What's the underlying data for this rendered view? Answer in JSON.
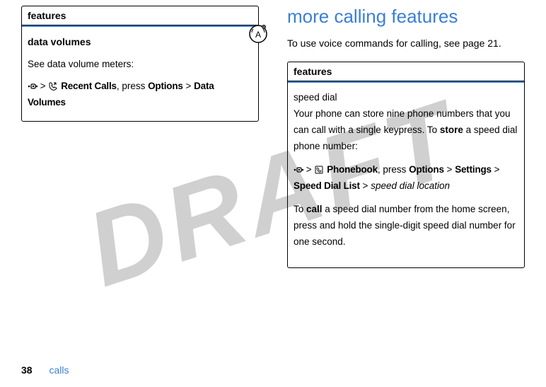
{
  "watermark": "DRAFT",
  "left": {
    "features_header": "features",
    "row_title": "data volumes",
    "row_desc": "See data volume meters:",
    "path": {
      "gt1": ">",
      "item1": "Recent Calls",
      "press": ", press ",
      "item2": "Options",
      "gt2": ">",
      "item3": "Data Volumes"
    }
  },
  "right": {
    "heading": "more calling features",
    "intro": "To use voice commands for calling, see page 21.",
    "features_header": "features",
    "row_title": "speed dial",
    "para1_a": "Your phone can store nine phone numbers that you can call with a single keypress. To ",
    "para1_b": "store",
    "para1_c": " a speed dial phone number:",
    "path": {
      "gt1": ">",
      "item1": "Phonebook",
      "press": ", press ",
      "item2": "Options",
      "gt2": ">",
      "item3": "Settings",
      "gt3": ">",
      "item4": "Speed Dial List",
      "gt4": ">",
      "loc": "speed dial location"
    },
    "para2_a": "To ",
    "para2_b": "call",
    "para2_c": " a speed dial number from the home screen, press and hold the single-digit speed dial number for one second."
  },
  "footer": {
    "page": "38",
    "section": "calls"
  }
}
